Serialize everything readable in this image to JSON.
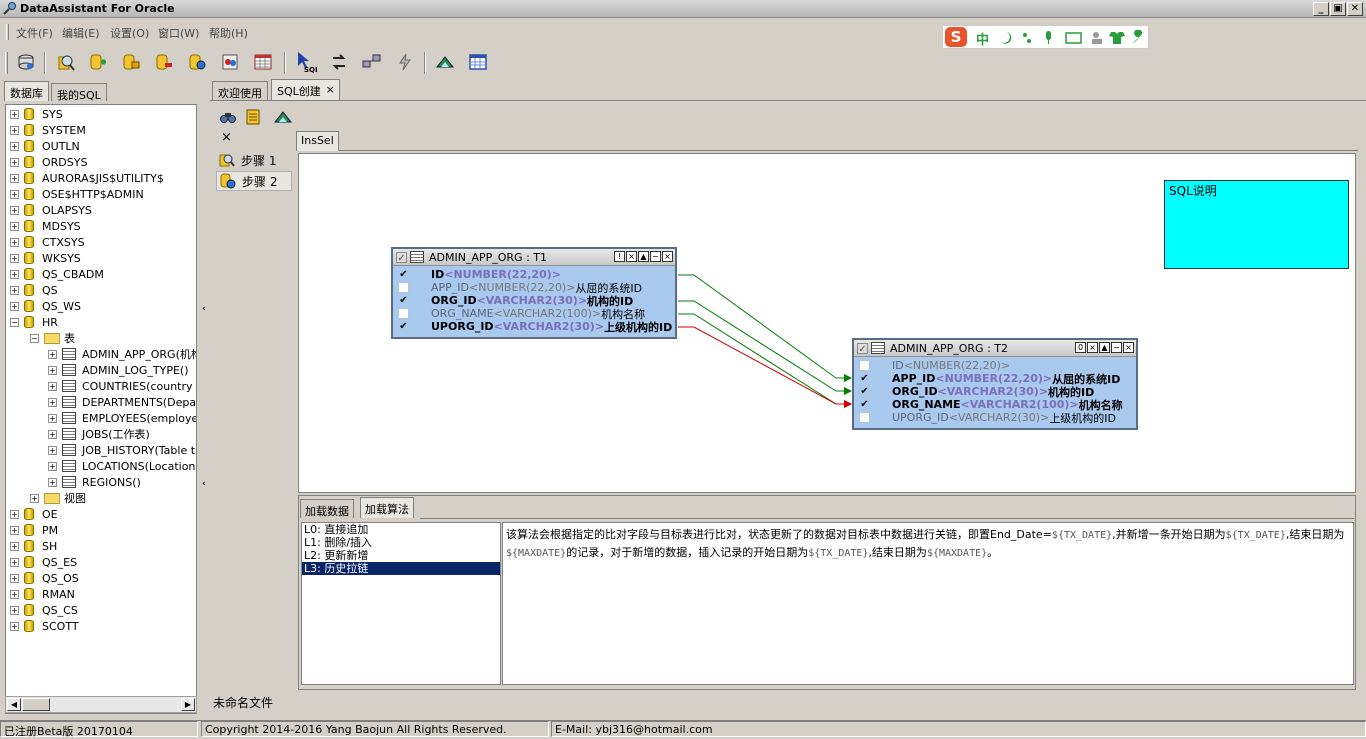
{
  "window": {
    "title": "DataAssistant For Oracle",
    "min": "_",
    "restore": "▣",
    "close": "✕"
  },
  "menu": [
    "文件(F)",
    "编辑(E)",
    "设置(O)",
    "窗口(W)",
    "帮助(H)"
  ],
  "ime": {
    "brand": "S",
    "lang": "中"
  },
  "left_tabs": [
    "数据库",
    "我的SQL"
  ],
  "tree": {
    "schemas_top": [
      "SYS",
      "SYSTEM",
      "OUTLN",
      "ORDSYS",
      "AURORA$JIS$UTILITY$",
      "OSE$HTTP$ADMIN",
      "OLAPSYS",
      "MDSYS",
      "CTXSYS",
      "WKSYS",
      "QS_CBADM",
      "QS",
      "QS_WS"
    ],
    "hr": "HR",
    "tables_folder": "表",
    "tables": [
      "ADMIN_APP_ORG(机构",
      "ADMIN_LOG_TYPE()",
      "COUNTRIES(country ta",
      "DEPARTMENTS(Departr",
      "EMPLOYEES(employees",
      "JOBS(工作表)",
      "JOB_HISTORY(Table th",
      "LOCATIONS(Locations",
      "REGIONS()"
    ],
    "views_folder": "视图",
    "schemas_bottom": [
      "OE",
      "PM",
      "SH",
      "QS_ES",
      "QS_OS",
      "RMAN",
      "QS_CS",
      "SCOTT"
    ]
  },
  "doc_tabs": [
    "欢迎使用",
    "SQL创建"
  ],
  "doc_tab_close": "×",
  "steps_close": "×",
  "steps": [
    "步骤  1",
    "步骤  2"
  ],
  "inner_tab": "InsSel",
  "t1": {
    "title": "ADMIN_APP_ORG : T1",
    "rows": [
      {
        "checked": true,
        "name": "ID",
        "type": "<NUMBER(22,20)>",
        "comment": ""
      },
      {
        "checked": false,
        "name": "APP_ID",
        "type": "<NUMBER(22,20)>",
        "comment": "从屈的系统ID"
      },
      {
        "checked": true,
        "name": "ORG_ID",
        "type": "<VARCHAR2(30)>",
        "comment": "机构的ID"
      },
      {
        "checked": false,
        "name": "ORG_NAME",
        "type": "<VARCHAR2(100)>",
        "comment": "机构名称"
      },
      {
        "checked": true,
        "name": "UPORG_ID",
        "type": "<VARCHAR2(30)>",
        "comment": "上级机构的ID"
      }
    ]
  },
  "t2": {
    "title": "ADMIN_APP_ORG : T2",
    "rows": [
      {
        "checked": false,
        "name": "ID",
        "type": "<NUMBER(22,20)>",
        "comment": ""
      },
      {
        "checked": true,
        "name": "APP_ID",
        "type": "<NUMBER(22,20)>",
        "comment": "从屈的系统ID"
      },
      {
        "checked": true,
        "name": "ORG_ID",
        "type": "<VARCHAR2(30)>",
        "comment": "机构的ID"
      },
      {
        "checked": true,
        "name": "ORG_NAME",
        "type": "<VARCHAR2(100)>",
        "comment": "机构名称"
      },
      {
        "checked": false,
        "name": "UPORG_ID",
        "type": "<VARCHAR2(30)>",
        "comment": "上级机构的ID"
      }
    ]
  },
  "sql_note": "SQL说明",
  "bottom_tabs": [
    "加载数据",
    "加载算法"
  ],
  "algorithms": [
    "L0: 直接追加",
    "L1: 删除/插入",
    "L2: 更新新增",
    "L3: 历史拉链"
  ],
  "selected_algorithm": 3,
  "algo_desc": {
    "p1": "该算法会根据指定的比对字段与目标表进行比对，状态更新了的数据对目标表中数据进行关链，即置End_Date=",
    "v1": "${TX_DATE}",
    "p2": ",并新增一条开始日期为",
    "v2": "${TX_DATE}",
    "p3": ",结束日期为",
    "v3": "${MAXDATE}",
    "p4": "的记录，对于新增的数据，插入记录的开始日期为",
    "v4": "${TX_DATE}",
    "p5": ",结束日期为",
    "v5": "${MAXDATE}",
    "p6": "。"
  },
  "file_label": "未命名文件",
  "status": {
    "left": "已注册Beta版  20170104",
    "mid": "Copyright 2014-2016  Yang Baojun  All Rights Reserved.",
    "right": "E-Mail: ybj316@hotmail.com"
  },
  "colors": {
    "accent": "#00ffff",
    "er_body": "#a9c9ee",
    "selected": "#0a246a",
    "link_green": "#008000",
    "link_red": "#d00000"
  }
}
